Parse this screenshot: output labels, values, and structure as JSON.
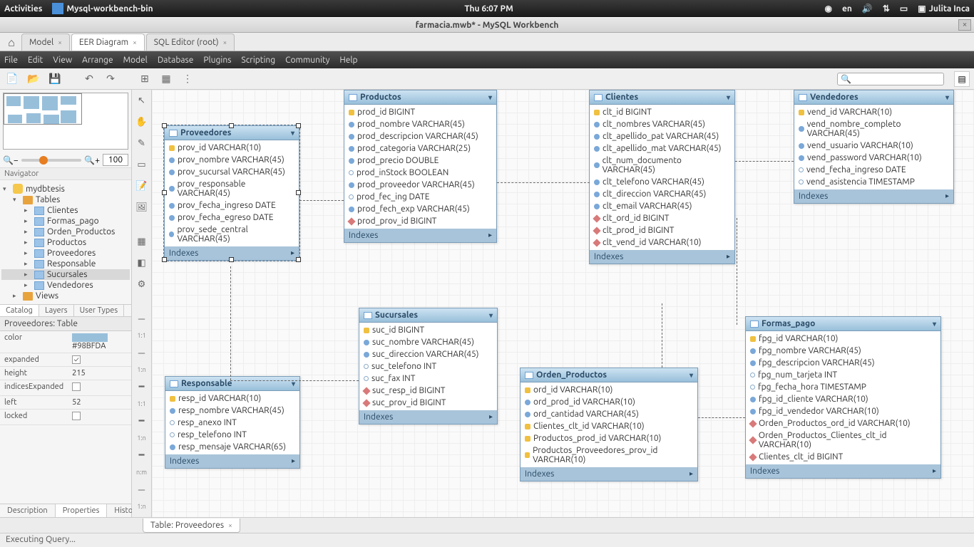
{
  "os": {
    "activities": "Activities",
    "app_task": "Mysql-workbench-bin",
    "clock": "Thu 6:07 PM",
    "lang": "en",
    "user": "Julita Inca"
  },
  "window": {
    "title": "farmacia.mwb* - MySQL Workbench"
  },
  "tabs": {
    "items": [
      "Model",
      "EER Diagram",
      "SQL Editor (root)"
    ],
    "active": 1
  },
  "menu": [
    "File",
    "Edit",
    "View",
    "Arrange",
    "Model",
    "Database",
    "Plugins",
    "Scripting",
    "Community",
    "Help"
  ],
  "zoom": {
    "value": "100",
    "label": "Navigator"
  },
  "schema_tree": {
    "db": "mydbtesis",
    "tables_label": "Tables",
    "tables": [
      "Clientes",
      "Formas_pago",
      "Orden_Productos",
      "Productos",
      "Proveedores",
      "Responsable",
      "Sucursales",
      "Vendedores"
    ],
    "selected": "Sucursales",
    "views_label": "Views"
  },
  "catalog_tabs": [
    "Catalog",
    "Layers",
    "User Types"
  ],
  "props": {
    "title": "Proveedores: Table",
    "rows": [
      {
        "k": "color",
        "v": "#98BFDA",
        "swatch": true
      },
      {
        "k": "expanded",
        "v": "",
        "check": true,
        "checked": true
      },
      {
        "k": "height",
        "v": "215"
      },
      {
        "k": "indicesExpanded",
        "v": "",
        "check": true,
        "checked": false
      },
      {
        "k": "left",
        "v": "52"
      },
      {
        "k": "locked",
        "v": "",
        "check": true,
        "checked": false
      }
    ]
  },
  "bottom_panel_tabs": [
    "Description",
    "Properties",
    "History"
  ],
  "bottom_tab": {
    "label": "Table: Proveedores"
  },
  "status": "Executing Query...",
  "entities": {
    "proveedores": {
      "title": "Proveedores",
      "fields": [
        {
          "icon": "key",
          "text": "prov_id VARCHAR(10)"
        },
        {
          "icon": "blue",
          "text": "prov_nombre VARCHAR(45)"
        },
        {
          "icon": "blue",
          "text": "prov_sucursal VARCHAR(45)"
        },
        {
          "icon": "blue",
          "text": "prov_responsable VARCHAR(45)"
        },
        {
          "icon": "blue",
          "text": "prov_fecha_ingreso DATE"
        },
        {
          "icon": "blue",
          "text": "prov_fecha_egreso DATE"
        },
        {
          "icon": "blue",
          "text": "prov_sede_central VARCHAR(45)"
        }
      ]
    },
    "productos": {
      "title": "Productos",
      "fields": [
        {
          "icon": "key",
          "text": "prod_id BIGINT"
        },
        {
          "icon": "blue",
          "text": "prod_nombre VARCHAR(45)"
        },
        {
          "icon": "blue",
          "text": "prod_descripcion VARCHAR(45)"
        },
        {
          "icon": "blue",
          "text": "prod_categoria VARCHAR(25)"
        },
        {
          "icon": "blue",
          "text": "prod_precio DOUBLE"
        },
        {
          "icon": "hollow",
          "text": "prod_inStock BOOLEAN"
        },
        {
          "icon": "blue",
          "text": "prod_proveedor VARCHAR(45)"
        },
        {
          "icon": "hollow",
          "text": "prod_fec_ing DATE"
        },
        {
          "icon": "blue",
          "text": "prod_fech_exp VARCHAR(45)"
        },
        {
          "icon": "red",
          "text": "prod_prov_id BIGINT"
        }
      ]
    },
    "clientes": {
      "title": "Clientes",
      "fields": [
        {
          "icon": "key",
          "text": "clt_id BIGINT"
        },
        {
          "icon": "blue",
          "text": "clt_nombres VARCHAR(45)"
        },
        {
          "icon": "blue",
          "text": "clt_apellido_pat VARCHAR(45)"
        },
        {
          "icon": "blue",
          "text": "clt_apellido_mat VARCHAR(45)"
        },
        {
          "icon": "blue",
          "text": "clt_num_documento VARCHAR(45)"
        },
        {
          "icon": "blue",
          "text": "clt_telefono VARCHAR(45)"
        },
        {
          "icon": "blue",
          "text": "clt_direccion VARCHAR(45)"
        },
        {
          "icon": "blue",
          "text": "clt_email VARCHAR(45)"
        },
        {
          "icon": "red",
          "text": "clt_ord_id BIGINT"
        },
        {
          "icon": "red",
          "text": "clt_prod_id BIGINT"
        },
        {
          "icon": "red",
          "text": "clt_vend_id VARCHAR(10)"
        }
      ]
    },
    "vendedores": {
      "title": "Vendedores",
      "fields": [
        {
          "icon": "key",
          "text": "vend_id VARCHAR(10)"
        },
        {
          "icon": "blue",
          "text": "vend_nombre_completo VARCHAR(45)"
        },
        {
          "icon": "blue",
          "text": "vend_usuario VARCHAR(10)"
        },
        {
          "icon": "blue",
          "text": "vend_password VARCHAR(10)"
        },
        {
          "icon": "hollow",
          "text": "vend_fecha_ingreso DATE"
        },
        {
          "icon": "hollow",
          "text": "vend_asistencia TIMESTAMP"
        }
      ]
    },
    "sucursales": {
      "title": "Sucursales",
      "fields": [
        {
          "icon": "key",
          "text": "suc_id BIGINT"
        },
        {
          "icon": "blue",
          "text": "suc_nombre VARCHAR(45)"
        },
        {
          "icon": "blue",
          "text": "suc_direccion VARCHAR(45)"
        },
        {
          "icon": "hollow",
          "text": "suc_telefono INT"
        },
        {
          "icon": "hollow",
          "text": "suc_fax INT"
        },
        {
          "icon": "red",
          "text": "suc_resp_id BIGINT"
        },
        {
          "icon": "red",
          "text": "suc_prov_id BIGINT"
        }
      ]
    },
    "responsable": {
      "title": "Responsable",
      "fields": [
        {
          "icon": "key",
          "text": "resp_id VARCHAR(10)"
        },
        {
          "icon": "blue",
          "text": "resp_nombre VARCHAR(45)"
        },
        {
          "icon": "hollow",
          "text": "resp_anexo INT"
        },
        {
          "icon": "hollow",
          "text": "resp_telefono INT"
        },
        {
          "icon": "blue",
          "text": "resp_mensaje VARCHAR(65)"
        }
      ]
    },
    "orden_productos": {
      "title": "Orden_Productos",
      "fields": [
        {
          "icon": "key",
          "text": "ord_id VARCHAR(10)"
        },
        {
          "icon": "blue",
          "text": "ord_prod_id VARCHAR(10)"
        },
        {
          "icon": "blue",
          "text": "ord_cantidad VARCHAR(45)"
        },
        {
          "icon": "key",
          "text": "Clientes_clt_id VARCHAR(10)"
        },
        {
          "icon": "key",
          "text": "Productos_prod_id VARCHAR(10)"
        },
        {
          "icon": "key",
          "text": "Productos_Proveedores_prov_id VARCHAR(10)"
        }
      ]
    },
    "formas_pago": {
      "title": "Formas_pago",
      "fields": [
        {
          "icon": "key",
          "text": "fpg_id VARCHAR(10)"
        },
        {
          "icon": "blue",
          "text": "fpg_nombre VARCHAR(45)"
        },
        {
          "icon": "blue",
          "text": "fpg_descripcion VARCHAR(45)"
        },
        {
          "icon": "hollow",
          "text": "fpg_num_tarjeta INT"
        },
        {
          "icon": "hollow",
          "text": "fpg_fecha_hora TIMESTAMP"
        },
        {
          "icon": "blue",
          "text": "fpg_id_cliente VARCHAR(10)"
        },
        {
          "icon": "blue",
          "text": "fpg_id_vendedor VARCHAR(10)"
        },
        {
          "icon": "red",
          "text": "Orden_Productos_ord_id VARCHAR(10)"
        },
        {
          "icon": "red",
          "text": "Orden_Productos_Clientes_clt_id VARCHAR(10)"
        },
        {
          "icon": "red",
          "text": "Clientes_clt_id BIGINT"
        }
      ]
    }
  },
  "indexes_label": "Indexes"
}
